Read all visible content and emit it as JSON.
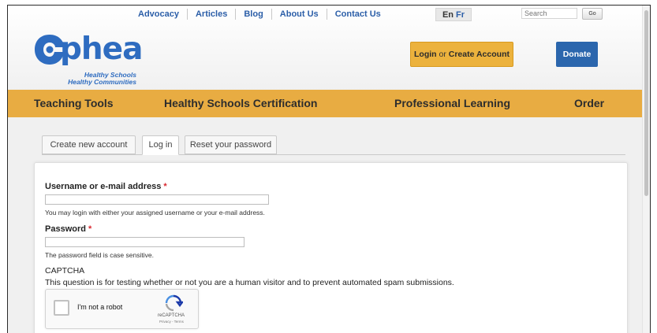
{
  "topnav": {
    "links": [
      "Advocacy",
      "Articles",
      "Blog",
      "About Us",
      "Contact Us"
    ],
    "lang_en": "En",
    "lang_fr": "Fr",
    "search_placeholder": "Search",
    "go_label": "Go"
  },
  "header": {
    "logo_word": "phea",
    "tagline_1": "Healthy Schools",
    "tagline_2": "Healthy Communities",
    "login_label": "Login",
    "or_label": "or",
    "create_label": "Create Account",
    "donate_label": "Donate"
  },
  "mainnav": {
    "items": [
      "Teaching Tools",
      "Healthy Schools Certification",
      "Professional Learning",
      "Order"
    ]
  },
  "tabs": [
    "Create new account",
    "Log in",
    "Reset your password"
  ],
  "form": {
    "username_label": "Username or e-mail address",
    "required_mark": "*",
    "username_help": "You may login with either your assigned username or your e-mail address.",
    "password_label": "Password",
    "password_help": "The password field is case sensitive.",
    "captcha_title": "CAPTCHA",
    "captcha_desc": "This question is for testing whether or not you are a human visitor and to prevent automated spam submissions.",
    "recaptcha_text": "I'm not a robot",
    "recaptcha_brand": "reCAPTCHA",
    "recaptcha_links": "Privacy - Terms"
  },
  "colors": {
    "brand_blue": "#2e6cc0",
    "nav_orange": "#e8ac42",
    "login_orange": "#ecb23d",
    "donate_blue": "#2b66ad",
    "required_red": "#d9282f"
  }
}
